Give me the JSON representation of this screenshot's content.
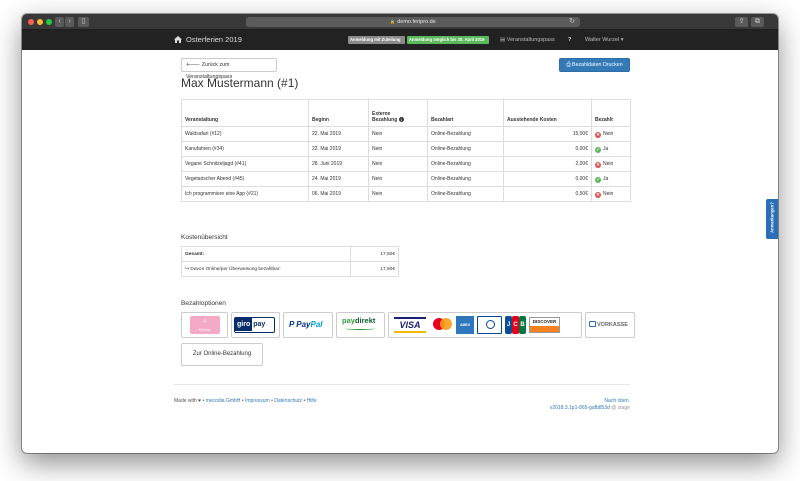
{
  "browser": {
    "url": "demo.feripro.de",
    "lock_icon": "lock-icon"
  },
  "navbar": {
    "brand": "Osterferien 2019",
    "badge_signup": "Anmeldung mit Zuteilung",
    "badge_open": "Anmeldung möglich bis 30. April 2019",
    "pass_link": "Veranstaltungspass",
    "help_icon": "?",
    "user": "Walter Wurzel",
    "user_caret": "▾",
    "colors": {
      "bar": "#222222",
      "badge_gray": "#8a8a8a",
      "badge_green": "#5cb85c"
    }
  },
  "page": {
    "back_button": "Zurück zum Veranstaltungspass",
    "print_button": "Bezahldaten Drucken",
    "title": "Max Mustermann (#1)"
  },
  "bookings": {
    "headers": {
      "event": "Veranstaltung",
      "start": "Beginn",
      "external_line1": "Externe",
      "external_line2": "Bezahlung",
      "payment_type": "Bezahlart",
      "outstanding": "Ausstehende Kosten",
      "paid": "Bezahlt"
    },
    "rows": [
      {
        "event": "Waldsafari (#12)",
        "start": "22. Mai 2019",
        "external": "Nein",
        "type": "Online-Bezahlung",
        "cost": "15,00€",
        "paid": "Nein",
        "paid_ok": false
      },
      {
        "event": "Kanufahren (#34)",
        "start": "22. Mai 2019",
        "external": "Nein",
        "type": "Online-Bezahlung",
        "cost": "0,00€",
        "paid": "Ja",
        "paid_ok": true
      },
      {
        "event": "Vegane Schnitzeljagd (#41)",
        "start": "28. Juni 2019",
        "external": "Nein",
        "type": "Online-Bezahlung",
        "cost": "2,00€",
        "paid": "Nein",
        "paid_ok": false
      },
      {
        "event": "Vegetarischer Abend (#45)",
        "start": "24. Mai 2019",
        "external": "Nein",
        "type": "Online-Bezahlung",
        "cost": "0,00€",
        "paid": "Ja",
        "paid_ok": true
      },
      {
        "event": "Ich programmiere eine App (#21)",
        "start": "06. Mai 2019",
        "external": "Nein",
        "type": "Online-Bezahlung",
        "cost": "0,50€",
        "paid": "Nein",
        "paid_ok": false
      }
    ],
    "status_colors": {
      "yes": "#5cb85c",
      "no": "#d9534f"
    }
  },
  "costs": {
    "heading": "Kostenübersicht",
    "total_label": "Gesamt:",
    "total_value": "17,50€",
    "online_label": "Davon Online/per Überweisung bezahlbar:",
    "online_prefix": "↪",
    "online_value": "17,50€"
  },
  "payment": {
    "heading": "Bezahloptionen",
    "methods": {
      "klarna": "Klarna.",
      "giropay_1": "giro",
      "giropay_2": "pay",
      "paypal_1": "Pay",
      "paypal_2": "Pal",
      "paydirekt_1": "pay",
      "paydirekt_2": "direkt",
      "visa": "VISA",
      "amex": "AMEX",
      "jcb_1": "J",
      "jcb_2": "C",
      "jcb_3": "B",
      "discover": "DISCOVER",
      "vorkasse": "VORKASSE"
    },
    "online_button": "Zur Online-Bezahlung"
  },
  "footer": {
    "made_with": "Made with ♥ •",
    "company": "mecodia GmbH",
    "sep": "•",
    "imprint": "Impressum",
    "privacy": "Datenschutz",
    "help": "Hilfe",
    "to_top": "Nach oben.",
    "version": "v2018.3.1p1-865-gafb853d",
    "stage": "stage"
  },
  "feedback_tab": "Anmerkungen?"
}
